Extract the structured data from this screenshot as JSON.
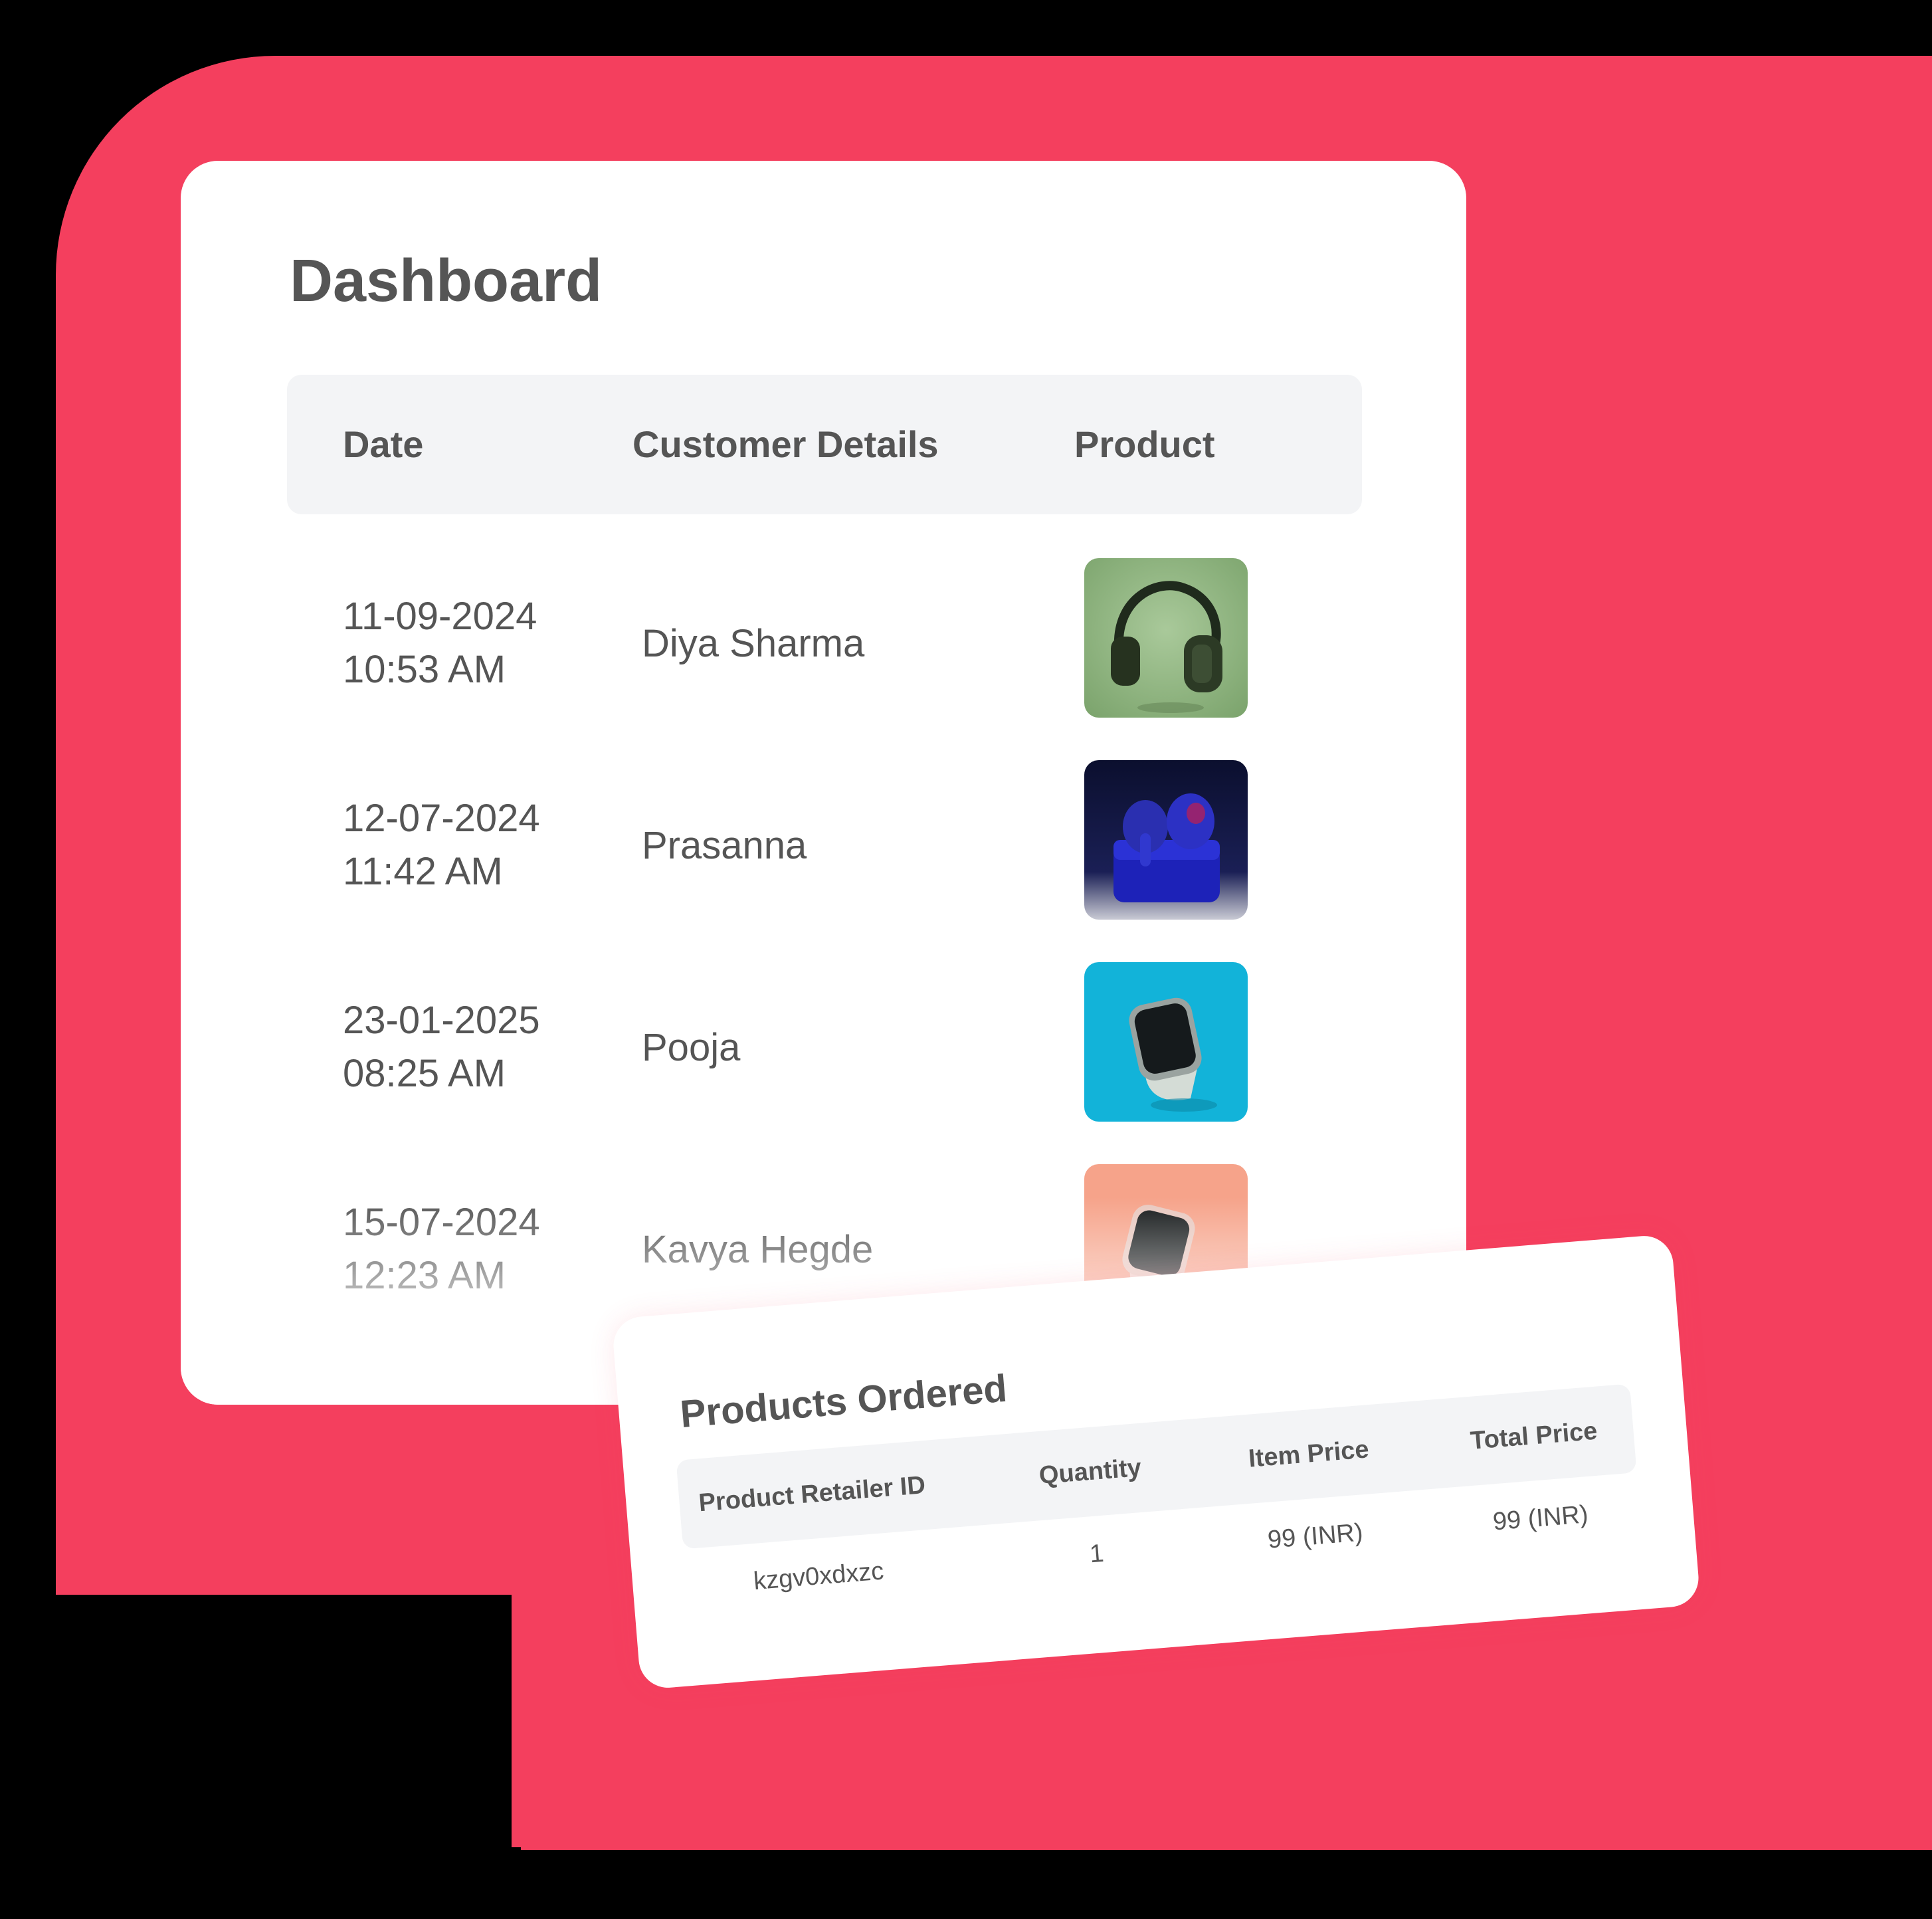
{
  "dashboard": {
    "title": "Dashboard",
    "columns": {
      "date": "Date",
      "customer": "Customer Details",
      "product": "Product"
    },
    "rows": [
      {
        "date": "11-09-2024",
        "time": "10:53 AM",
        "customer": "Diya Sharma",
        "product_icon": "headphones-image"
      },
      {
        "date": "12-07-2024",
        "time": "11:42 AM",
        "customer": "Prasanna",
        "product_icon": "earbuds-image"
      },
      {
        "date": "23-01-2025",
        "time": "08:25 AM",
        "customer": "Pooja",
        "product_icon": "smartwatch-blue-image"
      },
      {
        "date": "15-07-2024",
        "time": "12:23 AM",
        "customer": "Kavya Hegde",
        "product_icon": "smartwatch-pink-image"
      }
    ]
  },
  "orders": {
    "title": "Products Ordered",
    "columns": {
      "retailer_id": "Product Retailer ID",
      "quantity": "Quantity",
      "item_price": "Item Price",
      "total_price": "Total Price"
    },
    "row": {
      "retailer_id": "kzgv0xdxzc",
      "quantity": "1",
      "item_price": "99 (INR)",
      "total_price": "99 (INR)"
    }
  },
  "colors": {
    "background": "#f43f5e",
    "card": "#ffffff",
    "header_bg": "#f3f4f6",
    "text": "#555555"
  }
}
